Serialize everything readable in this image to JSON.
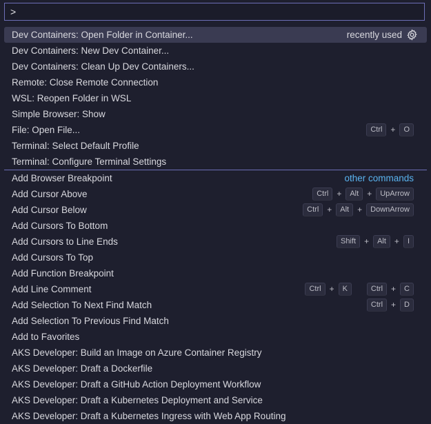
{
  "input": {
    "value": ">"
  },
  "recent": [
    {
      "label": "Dev Containers: Open Folder in Container...",
      "tag": "recently used",
      "gear": true,
      "selected": true
    },
    {
      "label": "Dev Containers: New Dev Container..."
    },
    {
      "label": "Dev Containers: Clean Up Dev Containers..."
    },
    {
      "label": "Remote: Close Remote Connection"
    },
    {
      "label": "WSL: Reopen Folder in WSL"
    },
    {
      "label": "Simple Browser: Show"
    },
    {
      "label": "File: Open File...",
      "keys": [
        [
          "Ctrl",
          "O"
        ]
      ]
    },
    {
      "label": "Terminal: Select Default Profile"
    },
    {
      "label": "Terminal: Configure Terminal Settings"
    }
  ],
  "other": [
    {
      "label": "Add Browser Breakpoint",
      "tag": "other commands"
    },
    {
      "label": "Add Cursor Above",
      "keys": [
        [
          "Ctrl",
          "Alt",
          "UpArrow"
        ]
      ]
    },
    {
      "label": "Add Cursor Below",
      "keys": [
        [
          "Ctrl",
          "Alt",
          "DownArrow"
        ]
      ]
    },
    {
      "label": "Add Cursors To Bottom"
    },
    {
      "label": "Add Cursors to Line Ends",
      "keys": [
        [
          "Shift",
          "Alt",
          "I"
        ]
      ]
    },
    {
      "label": "Add Cursors To Top"
    },
    {
      "label": "Add Function Breakpoint"
    },
    {
      "label": "Add Line Comment",
      "keys": [
        [
          "Ctrl",
          "K"
        ],
        [
          "Ctrl",
          "C"
        ]
      ]
    },
    {
      "label": "Add Selection To Next Find Match",
      "keys": [
        [
          "Ctrl",
          "D"
        ]
      ]
    },
    {
      "label": "Add Selection To Previous Find Match"
    },
    {
      "label": "Add to Favorites"
    },
    {
      "label": "AKS Developer: Build an Image on Azure Container Registry"
    },
    {
      "label": "AKS Developer: Draft a Dockerfile"
    },
    {
      "label": "AKS Developer: Draft a GitHub Action Deployment Workflow"
    },
    {
      "label": "AKS Developer: Draft a Kubernetes Deployment and Service"
    },
    {
      "label": "AKS Developer: Draft a Kubernetes Ingress with Web App Routing"
    }
  ]
}
